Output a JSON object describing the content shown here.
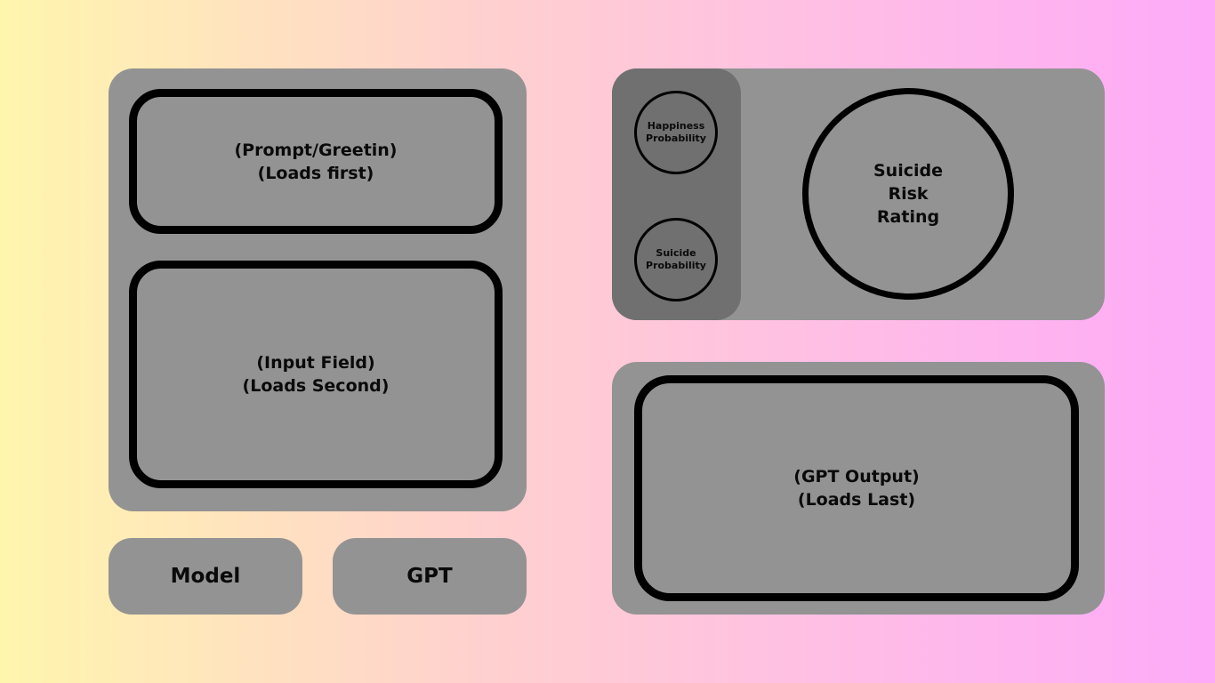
{
  "left_panel": {
    "prompt_box": {
      "lines": [
        "(Prompt/Greetin)",
        "(Loads first)"
      ]
    },
    "input_box": {
      "lines": [
        "(Input Field)",
        "(Loads Second)"
      ]
    }
  },
  "buttons": {
    "model_label": "Model",
    "gpt_label": "GPT"
  },
  "scores_panel": {
    "happiness": {
      "lines": [
        "Happiness",
        "Probability"
      ]
    },
    "suicide_prob": {
      "lines": [
        "Suicide",
        "Probability"
      ]
    },
    "risk_rating": {
      "lines": [
        "Suicide",
        "Risk",
        "Rating"
      ]
    }
  },
  "output_panel": {
    "output_box": {
      "lines": [
        "(GPT Output)",
        "(Loads Last)"
      ]
    }
  },
  "colors": {
    "panel": "#939393",
    "sidebar": "#707070",
    "outline": "#000000"
  }
}
